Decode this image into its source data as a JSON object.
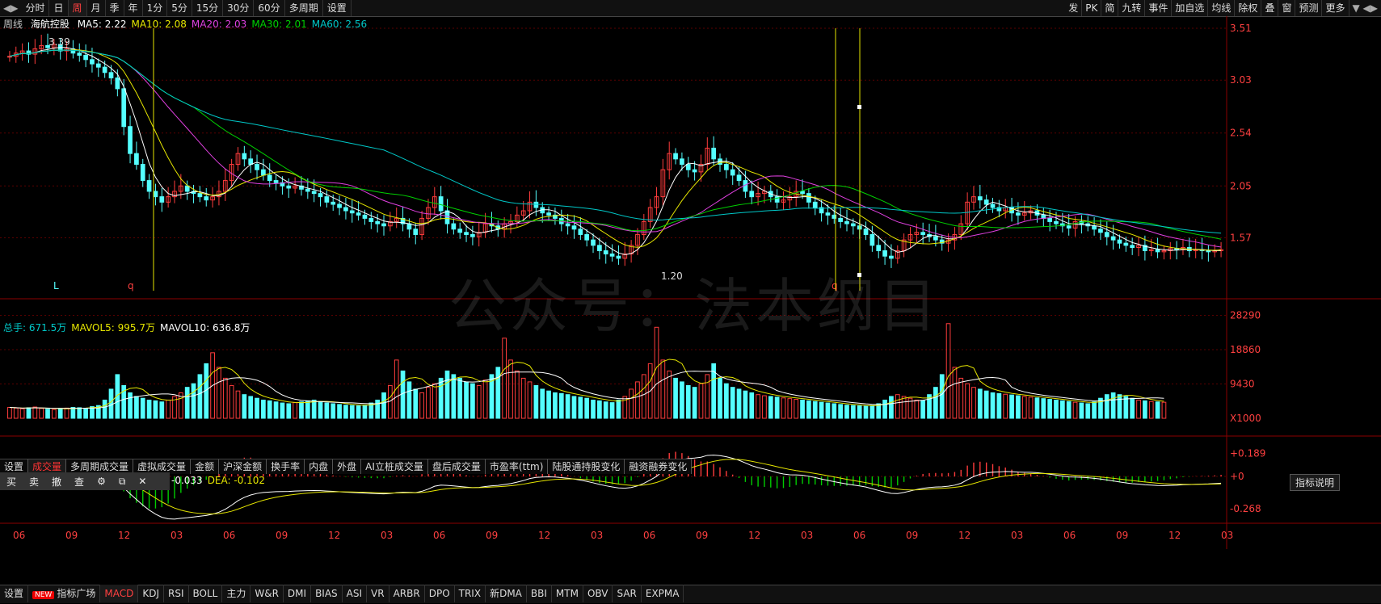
{
  "toolbar": {
    "left_tabs": [
      "分时",
      "日",
      "周",
      "月",
      "季",
      "年",
      "1分",
      "5分",
      "15分",
      "30分",
      "60分",
      "多周期",
      "设置"
    ],
    "active_tab": "周",
    "right_tabs": [
      "发",
      "PK",
      "简",
      "九转",
      "事件",
      "加自选",
      "均线",
      "除权",
      "叠",
      "窗",
      "预测",
      "更多"
    ]
  },
  "price_panel": {
    "period_label": "周线",
    "stock_name": "海航控股",
    "ma": [
      {
        "label": "MA5: 2.22",
        "color": "#ffffff"
      },
      {
        "label": "MA10: 2.08",
        "color": "#e6e600"
      },
      {
        "label": "MA20: 2.03",
        "color": "#e040e0"
      },
      {
        "label": "MA30: 2.01",
        "color": "#00d000"
      },
      {
        "label": "MA60: 2.56",
        "color": "#00c8c8"
      }
    ],
    "y_ticks": [
      "3.51",
      "3.03",
      "2.54",
      "2.05",
      "1.57"
    ],
    "max_label": "3.39",
    "min_label": "1.20",
    "markers": [
      "L",
      "q",
      "q"
    ]
  },
  "volume_panel": {
    "labels": [
      {
        "label": "总手: 671.5万",
        "color": "#00c8c8"
      },
      {
        "label": "MAVOL5: 995.7万",
        "color": "#e6e600"
      },
      {
        "label": "MAVOL10: 636.8万",
        "color": "#ffffff"
      }
    ],
    "y_ticks": [
      "28290",
      "18860",
      "9430",
      "X1000"
    ],
    "tabs": [
      "设置",
      "成交量",
      "多周期成交量",
      "虚拟成交量",
      "金额",
      "沪深金额",
      "换手率",
      "内盘",
      "外盘",
      "AI立桩成交量",
      "盘后成交量",
      "市盈率(ttm)",
      "陆股通持股变化",
      "融资融券变化"
    ],
    "active_tab": "成交量"
  },
  "macd_panel": {
    "trade_buttons": [
      "买",
      "卖",
      "撤",
      "查",
      "⚙",
      "⧉",
      "✕"
    ],
    "labels": [
      {
        "label": "-0.033",
        "color": "#ffffff"
      },
      {
        "label": "DEA: -0.102",
        "color": "#e6e600"
      }
    ],
    "y_ticks": [
      "+0.189",
      "+0",
      "-0.268"
    ],
    "help_button": "指标说明"
  },
  "x_axis": {
    "ticks": [
      "06",
      "09",
      "12",
      "03",
      "06",
      "09",
      "12",
      "03",
      "06",
      "09",
      "12",
      "03",
      "06",
      "09",
      "12",
      "03",
      "06",
      "09",
      "12",
      "03",
      "06",
      "09",
      "12",
      "03"
    ]
  },
  "bottom_tabs": {
    "items": [
      "设置",
      "指标广场",
      "MACD",
      "KDJ",
      "RSI",
      "BOLL",
      "主力",
      "W&R",
      "DMI",
      "BIAS",
      "ASI",
      "VR",
      "ARBR",
      "DPO",
      "TRIX",
      "新DMA",
      "BBI",
      "MTM",
      "OBV",
      "SAR",
      "EXPMA"
    ],
    "new_tag": "NEW",
    "active": "MACD"
  },
  "watermark": "公众号：法本纲目",
  "colors": {
    "up": "#ff3c3c",
    "down": "#54ffff",
    "grid": "#5a0000",
    "axis": "#8b0000"
  },
  "chart_data": {
    "type": "candlestick",
    "title": "海航控股 周线",
    "price_range": [
      1.08,
      3.51
    ],
    "ma_latest": {
      "MA5": 2.22,
      "MA10": 2.08,
      "MA20": 2.03,
      "MA30": 2.01,
      "MA60": 2.56
    },
    "close": [
      3.25,
      3.28,
      3.3,
      3.27,
      3.32,
      3.35,
      3.33,
      3.36,
      3.3,
      3.32,
      3.28,
      3.26,
      3.22,
      3.18,
      3.15,
      3.1,
      3.05,
      2.95,
      2.6,
      2.35,
      2.25,
      2.1,
      2.0,
      1.95,
      1.9,
      1.95,
      2.0,
      2.05,
      2.0,
      1.98,
      1.95,
      1.92,
      1.95,
      2.0,
      2.1,
      2.25,
      2.35,
      2.3,
      2.25,
      2.2,
      2.15,
      2.1,
      2.08,
      2.05,
      2.03,
      2.05,
      2.02,
      2.0,
      1.98,
      1.95,
      1.9,
      1.88,
      1.85,
      1.82,
      1.8,
      1.78,
      1.75,
      1.72,
      1.7,
      1.68,
      1.72,
      1.75,
      1.7,
      1.65,
      1.6,
      1.75,
      1.85,
      1.95,
      1.82,
      1.7,
      1.65,
      1.62,
      1.6,
      1.58,
      1.62,
      1.7,
      1.68,
      1.65,
      1.7,
      1.72,
      1.78,
      1.82,
      1.9,
      1.85,
      1.8,
      1.78,
      1.75,
      1.7,
      1.68,
      1.65,
      1.6,
      1.55,
      1.5,
      1.45,
      1.42,
      1.4,
      1.38,
      1.42,
      1.5,
      1.6,
      1.72,
      1.85,
      1.95,
      2.2,
      2.35,
      2.3,
      2.25,
      2.2,
      2.18,
      2.25,
      2.4,
      2.3,
      2.25,
      2.2,
      2.15,
      2.1,
      2.0,
      1.95,
      1.98,
      2.0,
      1.95,
      1.9,
      1.92,
      1.95,
      2.0,
      1.98,
      1.9,
      1.85,
      1.8,
      1.78,
      1.75,
      1.72,
      1.7,
      1.68,
      1.65,
      1.6,
      1.5,
      1.45,
      1.4,
      1.38,
      1.45,
      1.55,
      1.6,
      1.62,
      1.6,
      1.58,
      1.55,
      1.52,
      1.55,
      1.6,
      1.7,
      1.9,
      1.95,
      1.92,
      1.88,
      1.85,
      1.82,
      1.85,
      1.8,
      1.78,
      1.8,
      1.82,
      1.78,
      1.75,
      1.72,
      1.7,
      1.68,
      1.66,
      1.72,
      1.7,
      1.68,
      1.65,
      1.62,
      1.58,
      1.55,
      1.52,
      1.5,
      1.48,
      1.5,
      1.45,
      1.46,
      1.44,
      1.45,
      1.47,
      1.46,
      1.48,
      1.45,
      1.46,
      1.45,
      1.44,
      1.45,
      1.46
    ],
    "volume_x1000": [
      3000,
      2800,
      2600,
      2900,
      3100,
      2700,
      2500,
      2400,
      2600,
      2800,
      3000,
      2900,
      2700,
      3200,
      3500,
      5000,
      8000,
      12000,
      9000,
      7000,
      6000,
      5500,
      5000,
      4800,
      4500,
      5000,
      6000,
      7000,
      8500,
      9500,
      12000,
      15000,
      18000,
      14000,
      11000,
      9000,
      7500,
      6500,
      6000,
      5500,
      5000,
      4800,
      4500,
      4200,
      4000,
      4300,
      4500,
      4800,
      5000,
      4600,
      4200,
      4000,
      3800,
      3600,
      3500,
      3400,
      3600,
      4200,
      5000,
      7000,
      9000,
      16000,
      13000,
      10000,
      8000,
      7000,
      8500,
      9500,
      11000,
      13000,
      12000,
      11000,
      10000,
      9500,
      9000,
      10500,
      12000,
      14000,
      22000,
      16000,
      13000,
      11000,
      10000,
      9000,
      8000,
      7500,
      7000,
      6800,
      6500,
      6000,
      5800,
      5500,
      5000,
      4800,
      4500,
      4300,
      5000,
      6000,
      8000,
      10000,
      12000,
      15000,
      25000,
      16000,
      13000,
      11000,
      10000,
      9000,
      8500,
      9500,
      12000,
      15000,
      11000,
      9500,
      8500,
      8000,
      7500,
      7000,
      6500,
      6200,
      6000,
      5800,
      5600,
      5400,
      5200,
      5000,
      4800,
      4600,
      4400,
      4200,
      4000,
      3800,
      3600,
      3500,
      3400,
      3300,
      3500,
      4000,
      5000,
      6000,
      6500,
      6000,
      5500,
      5000,
      4800,
      6500,
      8500,
      12000,
      26000,
      14000,
      11000,
      9500,
      8500,
      8000,
      7500,
      7000,
      6800,
      6600,
      6400,
      6200,
      6000,
      5800,
      5600,
      5400,
      5200,
      5000,
      4800,
      4600,
      4400,
      4200,
      4000,
      4500,
      5500,
      6500,
      7000,
      6500,
      6000,
      5500,
      5000,
      4800,
      4600,
      4500,
      4400
    ]
  }
}
